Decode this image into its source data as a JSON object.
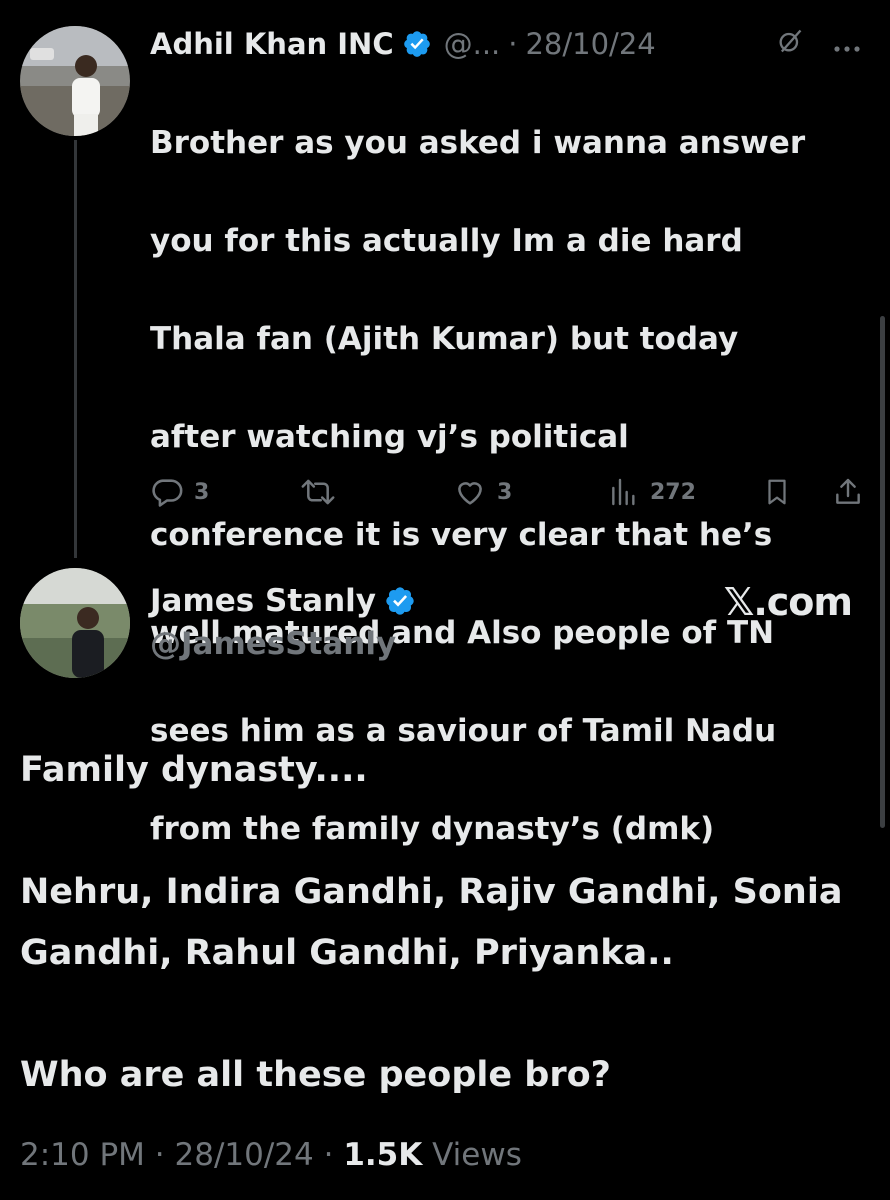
{
  "reply": {
    "display_name": "Adhil Khan INC",
    "handle_truncated": "@...",
    "date": "28/10/24",
    "text_lines": [
      "Brother as you asked i wanna  answer",
      "you for this actually Im a die hard",
      "Thala fan (Ajith Kumar) but today",
      "after watching vj’s political",
      "conference it is very clear that he’s",
      "well matured and Also people of TN",
      "sees him as a saviour of Tamil Nadu",
      "from the family dynasty’s (dmk)"
    ],
    "counts": {
      "replies": "3",
      "likes": "3",
      "views": "272"
    }
  },
  "main": {
    "display_name": "James Stanly",
    "handle": "@JamesStanly",
    "watermark": "𝕏.com",
    "paragraphs": [
      "Family dynasty....",
      "Nehru, Indira Gandhi, Rajiv Gandhi, Sonia Gandhi, Rahul Gandhi, Priyanka..",
      "Who are all these people bro?"
    ],
    "time": "2:10 PM",
    "date": "28/10/24",
    "views_count": "1.5K",
    "views_label": "Views"
  },
  "icons": {
    "verified": "verified-badge-icon",
    "grok": "grok-icon",
    "more": "more-icon",
    "reply": "reply-icon",
    "repost": "repost-icon",
    "like": "like-icon",
    "views": "views-icon",
    "bookmark": "bookmark-icon",
    "share": "share-icon"
  },
  "colors": {
    "background": "#000000",
    "text": "#e7e9ea",
    "muted": "#71767b",
    "verified": "#1d9bf0"
  }
}
